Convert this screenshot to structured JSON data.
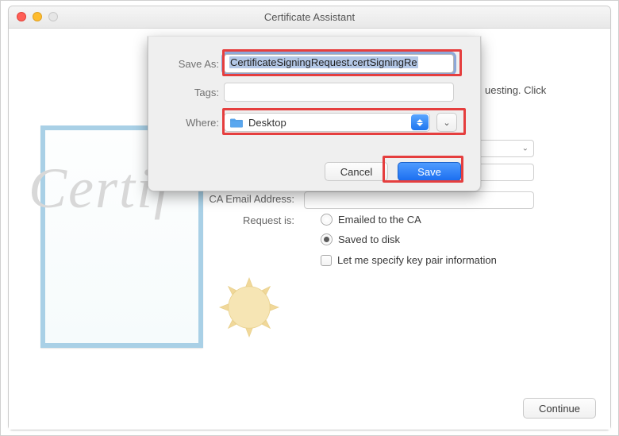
{
  "window": {
    "title": "Certificate Assistant"
  },
  "background": {
    "request_text_suffix": "uesting. Click",
    "ca_email_label": "CA Email Address:",
    "request_is_label": "Request is:",
    "radio_emailed_label": "Emailed to the CA",
    "radio_saved_label": "Saved to disk",
    "checkbox_label": "Let me specify key pair information",
    "continue_label": "Continue",
    "cert_script": "Certif"
  },
  "sheet": {
    "save_as_label": "Save As:",
    "save_as_value": "CertificateSigningRequest.certSigningRe",
    "tags_label": "Tags:",
    "tags_value": "",
    "where_label": "Where:",
    "where_value": "Desktop",
    "cancel_label": "Cancel",
    "save_label": "Save"
  }
}
